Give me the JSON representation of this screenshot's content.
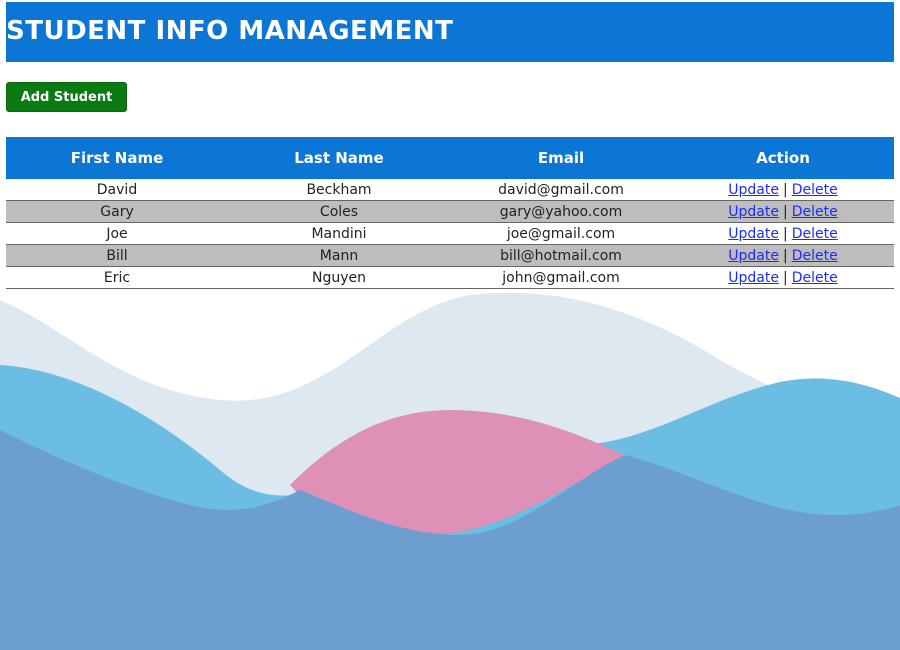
{
  "header": {
    "title": "STUDENT INFO MANAGEMENT"
  },
  "toolbar": {
    "add_label": "Add Student"
  },
  "table": {
    "columns": [
      "First Name",
      "Last Name",
      "Email",
      "Action"
    ],
    "rows": [
      {
        "first": "David",
        "last": "Beckham",
        "email": "david@gmail.com"
      },
      {
        "first": "Gary",
        "last": "Coles",
        "email": "gary@yahoo.com"
      },
      {
        "first": "Joe",
        "last": "Mandini",
        "email": "joe@gmail.com"
      },
      {
        "first": "Bill",
        "last": "Mann",
        "email": "bill@hotmail.com"
      },
      {
        "first": "Eric",
        "last": "Nguyen",
        "email": "john@gmail.com"
      }
    ],
    "action_update": "Update",
    "action_separator": "|",
    "action_delete": "Delete"
  },
  "colors": {
    "header_bg": "#0b76d4",
    "add_button_bg": "#0a7a12",
    "row_alt_bg": "#bdbdbd",
    "link": "#1a2cff"
  }
}
